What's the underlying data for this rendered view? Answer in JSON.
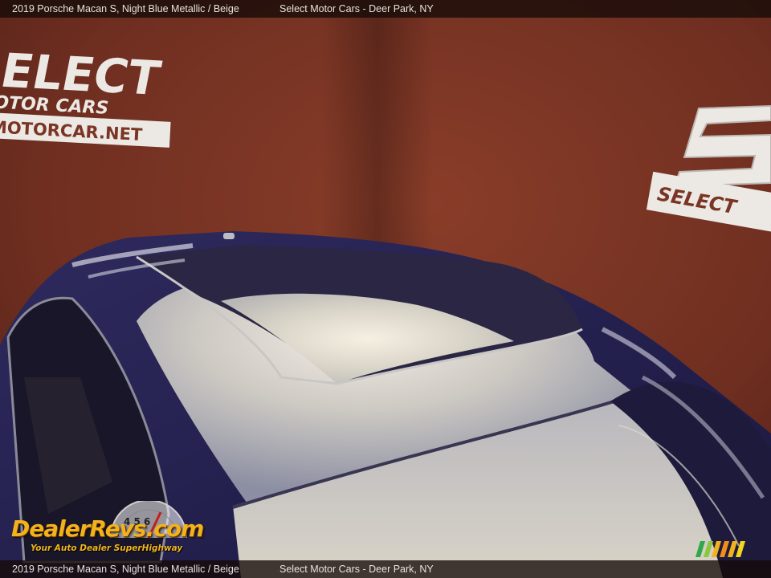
{
  "caption": {
    "car": "2019 Porsche Macan S,  Night Blue Metallic / Beige",
    "dealer": "Select Motor Cars - Deer Park, NY"
  },
  "wall_signs": {
    "left_line1": "SELECT",
    "left_line2": "MOTOR CARS",
    "left_line3": "MOTORCAR.NET",
    "right_line1": "SELECT"
  },
  "watermark": {
    "brand": "DealerRevs.com",
    "tagline": "Your Auto Dealer SuperHighway",
    "speedo_digits": "4 5 6"
  },
  "colors": {
    "wall": "#7a3524",
    "car_paint": "#26224f",
    "roof_glass": "#d6d3ce",
    "caption_bar": "#140a08",
    "watermark_gold": "#f2b21c"
  },
  "icons": {
    "speedometer": "speedometer-icon",
    "stripes": "accent-stripes-icon"
  }
}
